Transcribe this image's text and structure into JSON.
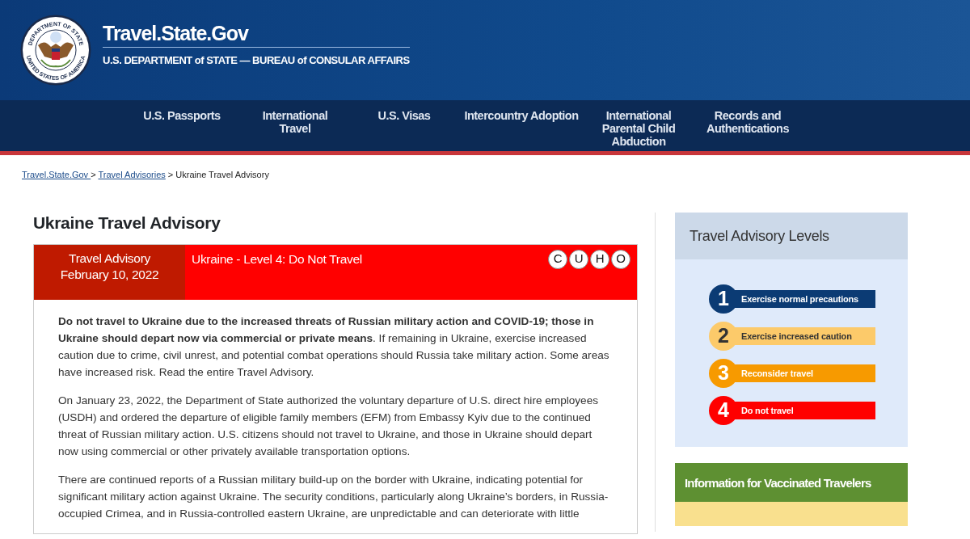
{
  "header": {
    "seal_top": "DEPARTMENT OF STATE",
    "seal_bottom": "UNITED STATES OF AMERICA",
    "title": "Travel.State.Gov",
    "subtitle": "U.S. DEPARTMENT of STATE — BUREAU of CONSULAR AFFAIRS"
  },
  "nav": [
    {
      "label": "U.S. Passports"
    },
    {
      "label": "International Travel"
    },
    {
      "label": "U.S. Visas"
    },
    {
      "label": "Intercountry Adoption"
    },
    {
      "label": "International Parental Child Abduction"
    },
    {
      "label": "Records and Authentications"
    }
  ],
  "breadcrumb": [
    {
      "label": "Travel.State.Gov ",
      "link": true
    },
    {
      "label": "Travel Advisories",
      "link": true
    },
    {
      "label": "Ukraine Travel Advisory",
      "link": false
    }
  ],
  "breadcrumb_separator": ">",
  "page_title": "Ukraine Travel Advisory",
  "advisory": {
    "label": "Travel Advisory",
    "date": "February 10, 2022",
    "level_title": "Ukraine - Level 4: Do Not Travel",
    "color": "#ff0000",
    "indicators": [
      "C",
      "U",
      "H",
      "O"
    ],
    "paragraphs": [
      "**Do not travel to Ukraine due to the increased threats of Russian military action and COVID-19; those in Ukraine should depart now via commercial or private means**. If remaining in Ukraine, exercise increased caution due to crime, civil unrest, and potential combat operations should Russia take military action. Some areas have increased risk. Read the entire Travel Advisory.",
      "On January 23, 2022, the Department of State authorized the voluntary departure of U.S. direct hire employees (USDH) and ordered the departure of eligible family members (EFM) from Embassy Kyiv due to the continued threat of Russian military action. U.S. citizens should not travel to Ukraine, and those in Ukraine should depart now using commercial or other privately available transportation options.",
      "There are continued reports of a Russian military build-up on the border with Ukraine, indicating potential for significant military action against Ukraine. The security conditions, particularly along Ukraine’s borders, in Russia-occupied Crimea, and in Russia-controlled eastern Ukraine, are unpredictable and can deteriorate with little"
    ]
  },
  "sidebar": {
    "levels_title": "Travel Advisory Levels",
    "levels": [
      {
        "number": "1",
        "label": "Exercise normal precautions",
        "color": "#0b3b74"
      },
      {
        "number": "2",
        "label": "Exercise increased caution",
        "color": "#fcca6a"
      },
      {
        "number": "3",
        "label": "Reconsider travel",
        "color": "#f79a00"
      },
      {
        "number": "4",
        "label": "Do not travel",
        "color": "#ff0000"
      }
    ],
    "vaccinated_title": "Information for Vaccinated Travelers"
  }
}
